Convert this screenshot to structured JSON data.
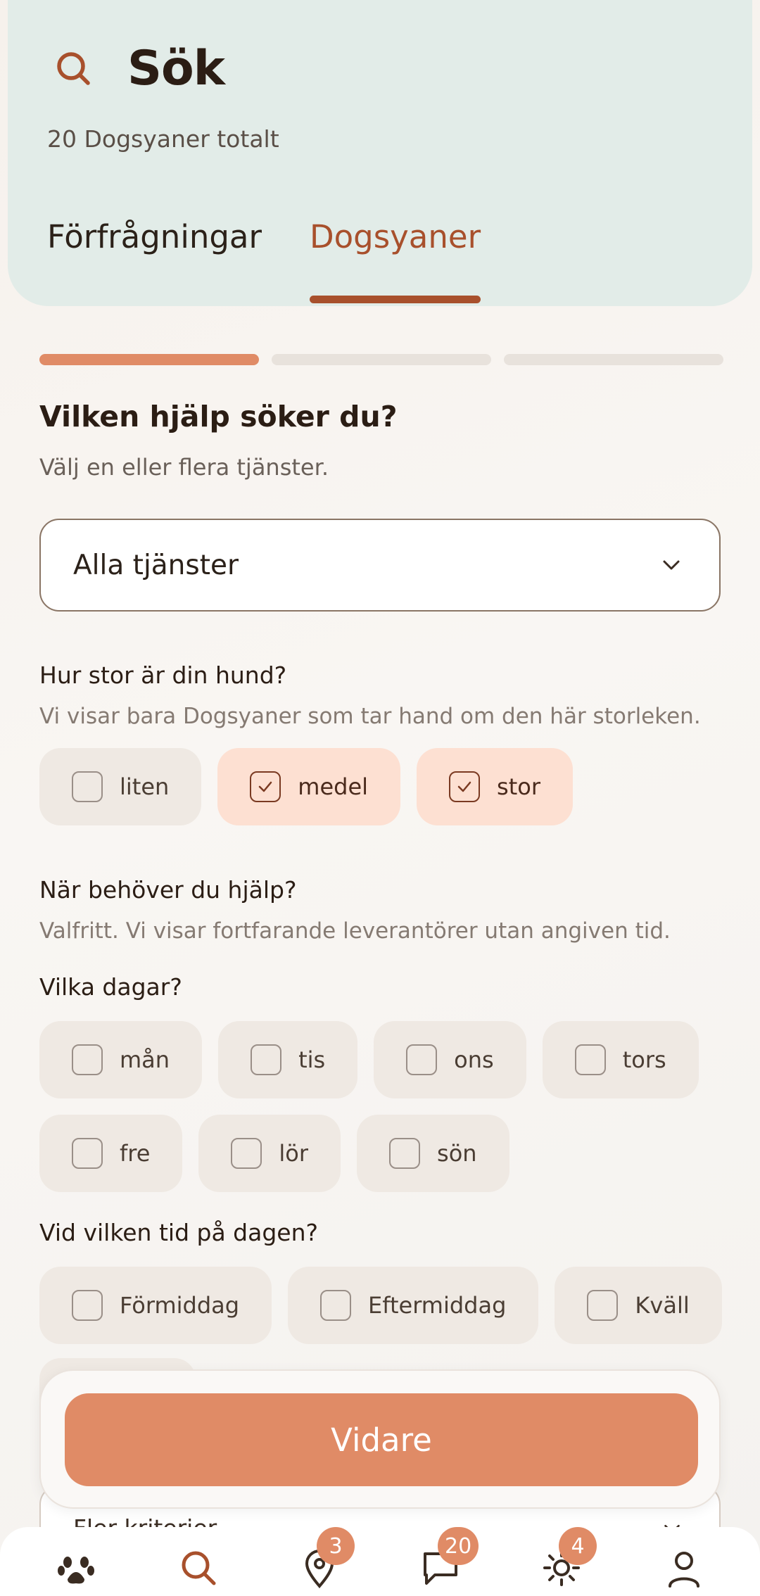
{
  "header": {
    "title": "Sök",
    "total": "20 Dogsyaner totalt",
    "tabs": [
      {
        "label": "Förfrågningar",
        "active": false
      },
      {
        "label": "Dogsyaner",
        "active": true
      }
    ]
  },
  "steps": {
    "total": 3,
    "current": 1
  },
  "question": {
    "title": "Vilken hjälp söker du?",
    "subtitle": "Välj en eller flera tjänster.",
    "select_value": "Alla tjänster"
  },
  "size": {
    "label": "Hur stor är din hund?",
    "hint": "Vi visar bara Dogsyaner som tar hand om den här storleken.",
    "options": [
      {
        "label": "liten",
        "checked": false
      },
      {
        "label": "medel",
        "checked": true
      },
      {
        "label": "stor",
        "checked": true
      }
    ]
  },
  "when": {
    "label": "När behöver du hjälp?",
    "hint": "Valfritt. Vi visar fortfarande leverantörer utan angiven tid."
  },
  "days": {
    "label": "Vilka dagar?",
    "options": [
      {
        "label": "mån",
        "checked": false
      },
      {
        "label": "tis",
        "checked": false
      },
      {
        "label": "ons",
        "checked": false
      },
      {
        "label": "tors",
        "checked": false
      },
      {
        "label": "fre",
        "checked": false
      },
      {
        "label": "lör",
        "checked": false
      },
      {
        "label": "sön",
        "checked": false
      }
    ]
  },
  "times": {
    "label": "Vid vilken tid på dagen?",
    "options": [
      {
        "label": "Förmiddag",
        "checked": false
      },
      {
        "label": "Eftermiddag",
        "checked": false
      },
      {
        "label": "Kväll",
        "checked": false
      }
    ]
  },
  "more_criteria": "Fler kriterier",
  "primary_button": "Vidare",
  "nav": {
    "items": [
      {
        "icon": "paw-icon",
        "badge": null
      },
      {
        "icon": "search-icon",
        "badge": null
      },
      {
        "icon": "location-pin-icon",
        "badge": "3"
      },
      {
        "icon": "chat-bubble-icon",
        "badge": "20"
      },
      {
        "icon": "sun-icon",
        "badge": "4"
      },
      {
        "icon": "person-icon",
        "badge": null
      }
    ]
  },
  "colors": {
    "accent": "#a8502c",
    "primary": "#e08b66",
    "header_bg": "#e2ece8",
    "chip_checked": "#fde0d2",
    "chip_default": "#efe9e3"
  }
}
